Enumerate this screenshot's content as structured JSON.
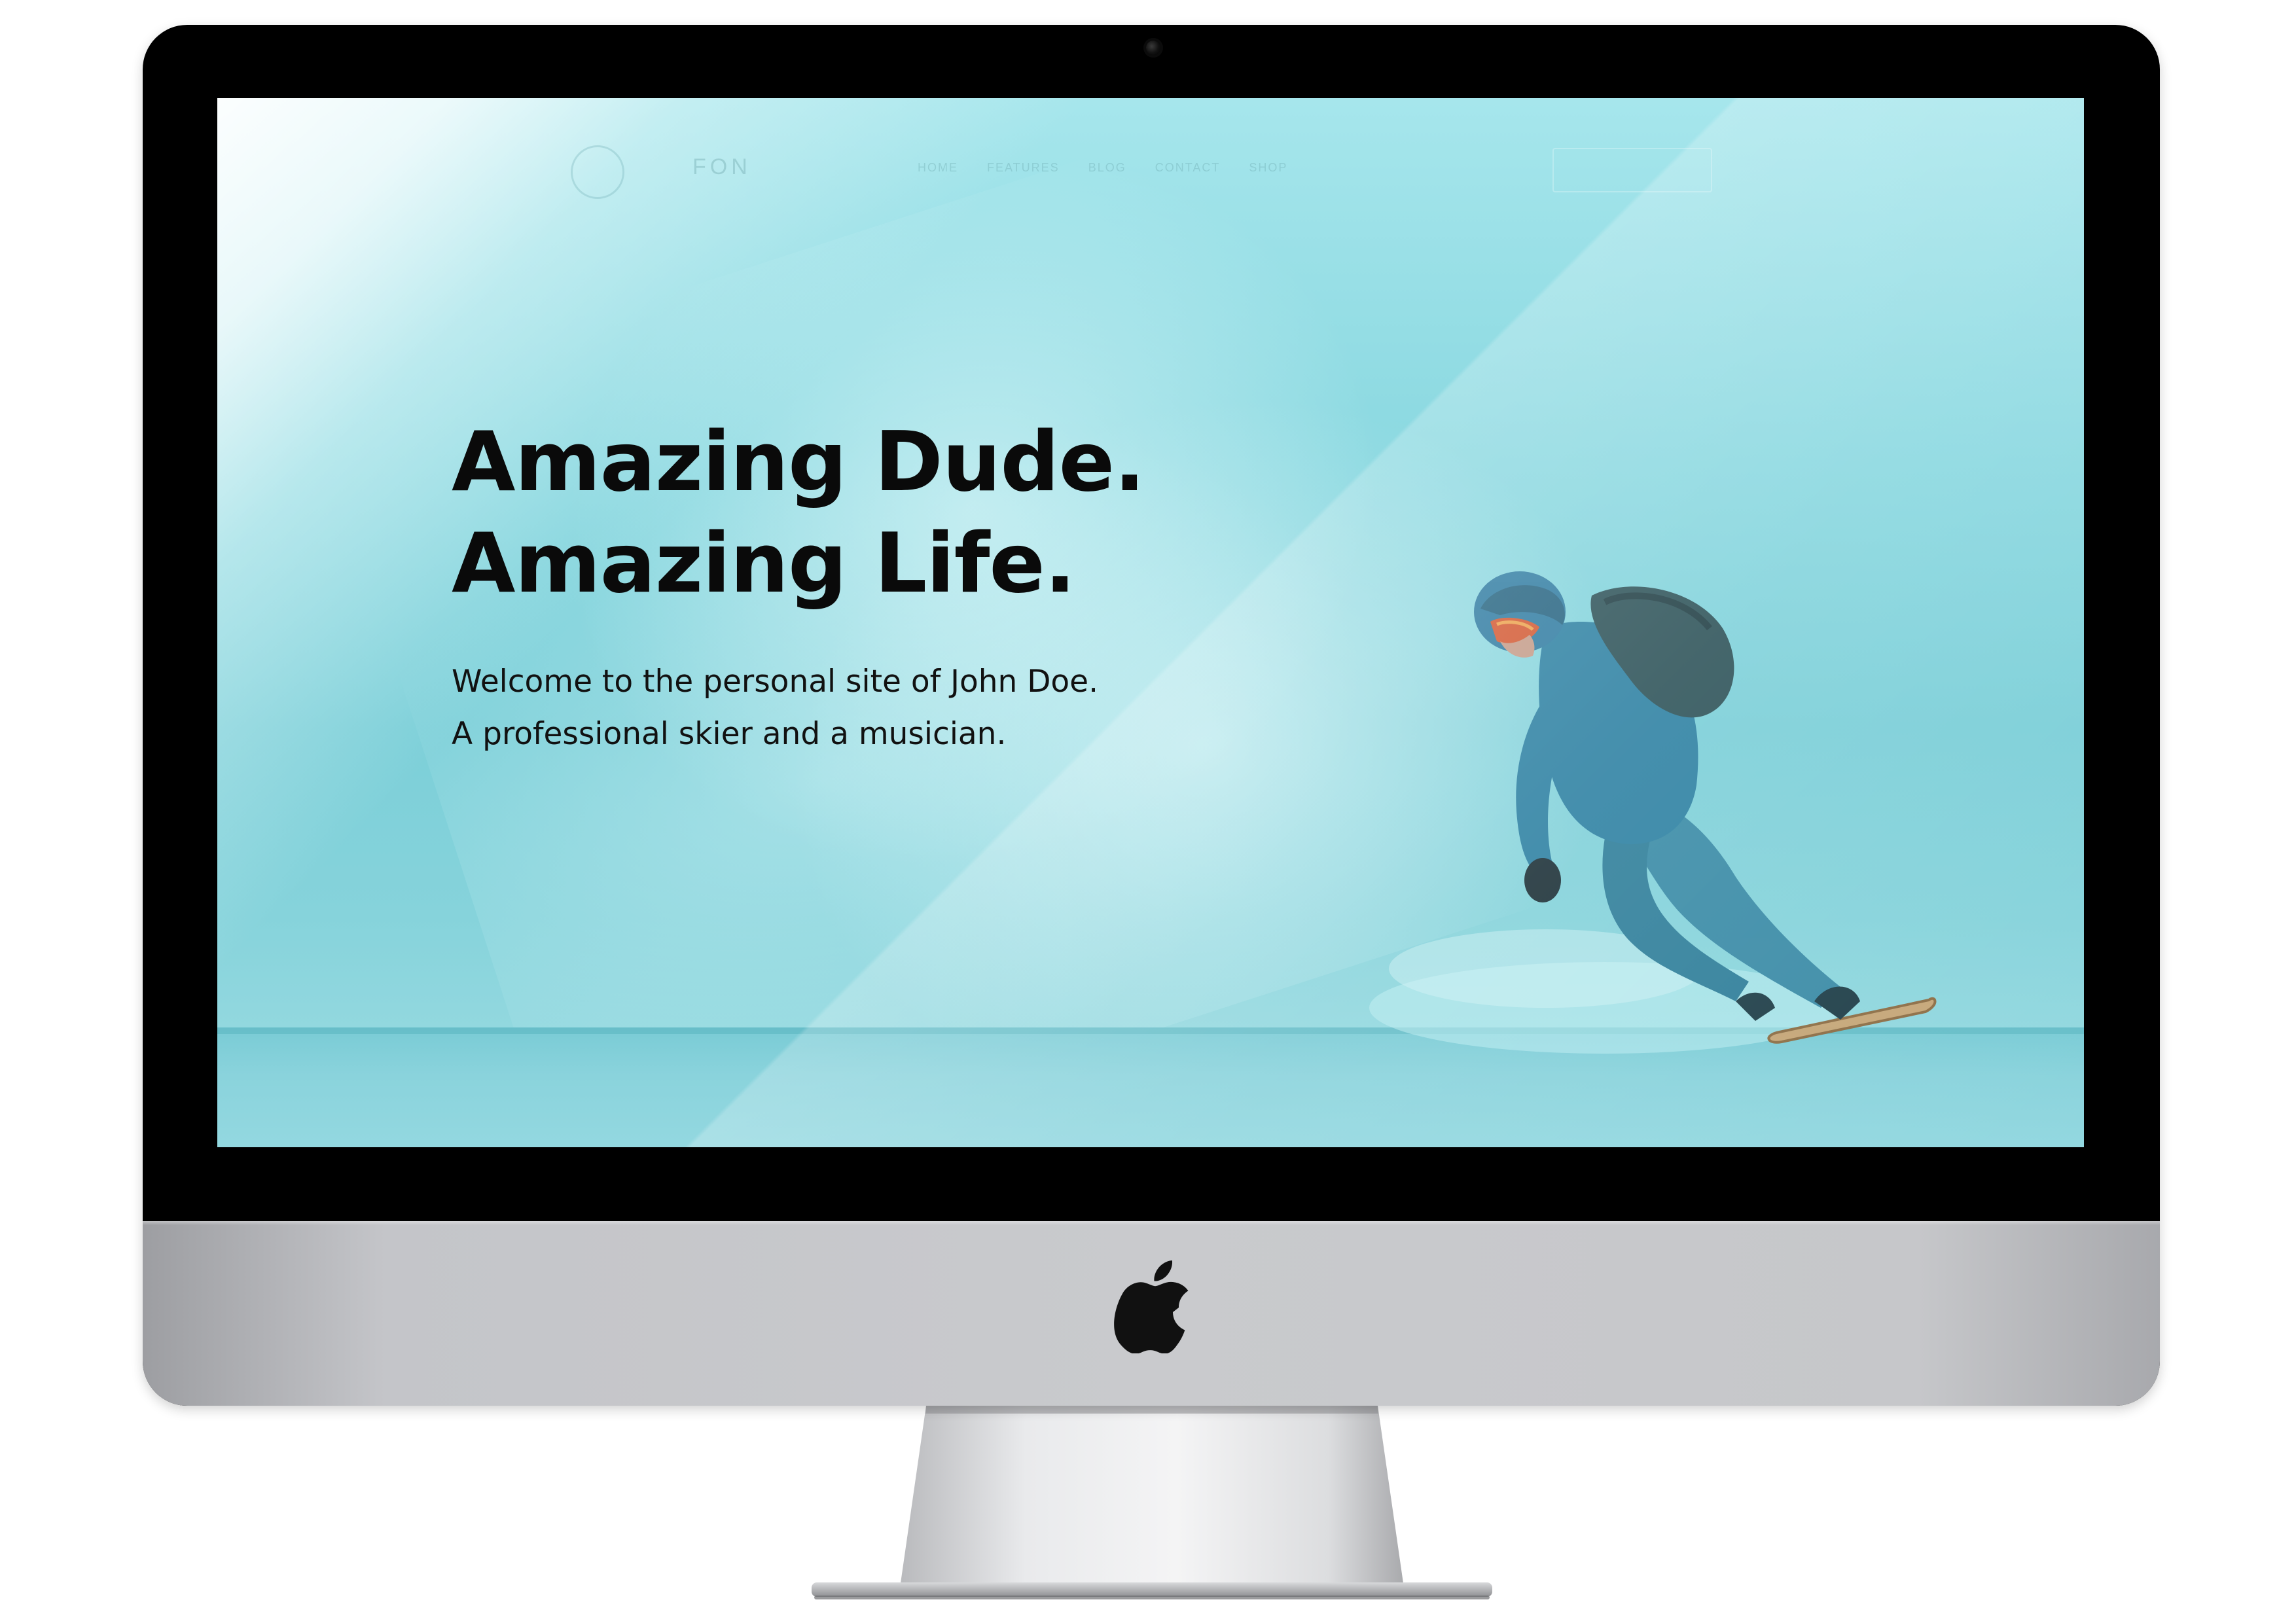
{
  "website": {
    "nav": {
      "logo_text": "FON",
      "links": [
        "HOME",
        "FEATURES",
        "BLOG",
        "CONTACT",
        "SHOP"
      ]
    },
    "hero": {
      "title_line1": "Amazing Dude.",
      "title_line2": "Amazing Life.",
      "subtitle_line1": "Welcome to the personal site of John Doe.",
      "subtitle_line2": "A professional skier and a musician."
    }
  },
  "device": {
    "type": "iMac",
    "logo_icon": "apple-logo-icon"
  },
  "colors": {
    "screen_tint": "#8ad8e0",
    "bezel": "#000000",
    "chin": "#c9cacd",
    "hero_text": "#0a0a0a"
  }
}
